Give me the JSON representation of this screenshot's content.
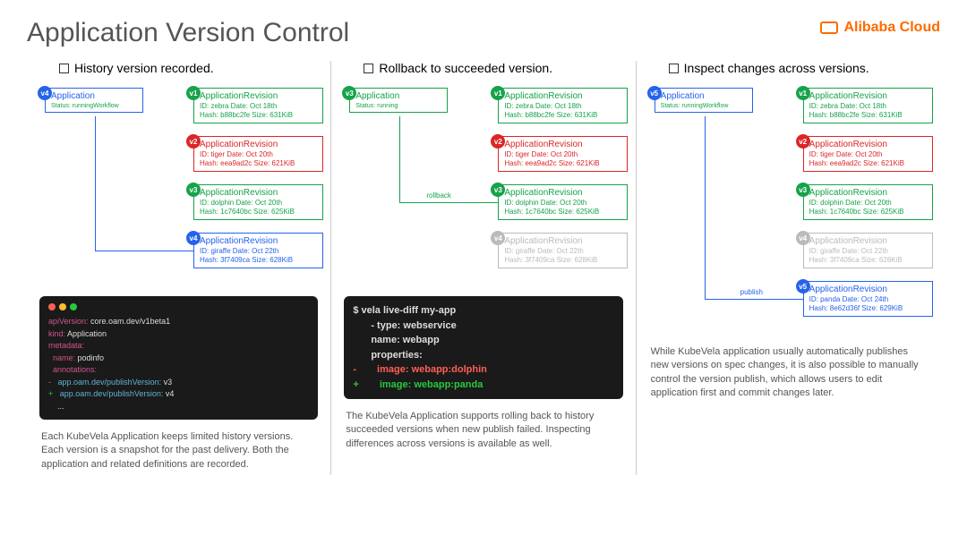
{
  "title": "Application Version Control",
  "logo": "Alibaba Cloud",
  "col1": {
    "heading": "History version recorded.",
    "app": {
      "title": "Application",
      "status": "Status: runningWorkflow",
      "badge": "v4"
    },
    "revs": [
      {
        "b": "v1",
        "t": "ApplicationRevision",
        "d": "ID: zebra Date: Oct 18th",
        "h": "Hash: b88bc2fe Size: 631KiB"
      },
      {
        "b": "v2",
        "t": "ApplicationRevision",
        "d": "ID: tiger Date: Oct 20th",
        "h": "Hash: eea9ad2c Size: 621KiB"
      },
      {
        "b": "v3",
        "t": "ApplicationRevision",
        "d": "ID: dolphin Date: Oct 20th",
        "h": "Hash: 1c7640bc Size: 625KiB"
      },
      {
        "b": "v4",
        "t": "ApplicationRevision",
        "d": "ID: giraffe Date: Oct 22th",
        "h": "Hash: 3f7409ca Size: 628KiB"
      }
    ],
    "code": {
      "l1": "apiVersion:",
      "v1": " core.oam.dev/v1beta1",
      "l2": "kind:",
      "v2": " Application",
      "l3": "metadata:",
      "l4": "name:",
      "v4": " podinfo",
      "l5": "annotations:",
      "l6": "app.oam.dev/publishVersion:",
      "v6a": " v3",
      "v6b": " v4",
      "l7": "..."
    },
    "desc": "Each KubeVela Application keeps limited history versions. Each version is a snapshot for the past delivery. Both the application and related definitions are recorded."
  },
  "col2": {
    "heading": "Rollback to succeeded version.",
    "app": {
      "title": "Application",
      "status": "Status: running",
      "badge": "v3"
    },
    "rollback": "rollback",
    "revs": [
      {
        "b": "v1",
        "t": "ApplicationRevision",
        "d": "ID: zebra Date: Oct 18th",
        "h": "Hash: b88bc2fe Size: 631KiB"
      },
      {
        "b": "v2",
        "t": "ApplicationRevision",
        "d": "ID: tiger Date: Oct 20th",
        "h": "Hash: eea9ad2c Size: 621KiB"
      },
      {
        "b": "v3",
        "t": "ApplicationRevision",
        "d": "ID: dolphin Date: Oct 20th",
        "h": "Hash: 1c7640bc Size: 625KiB"
      },
      {
        "b": "v4",
        "t": "ApplicationRevision",
        "d": "ID: giraffe Date: Oct 22th",
        "h": "Hash: 3f7409ca Size: 628KiB"
      }
    ],
    "code": {
      "cmd": "$ vela live-diff my-app",
      "l1": "- type: webservice",
      "l2": "  name: webapp",
      "l3": "  properties:",
      "l4": "-",
      "v4": "    image: webapp:dolphin",
      "l5": "+",
      "v5": "    image: webapp:panda"
    },
    "desc": "The KubeVela Application supports rolling back to history succeeded versions when new publish failed. Inspecting differences across versions is available as well."
  },
  "col3": {
    "heading": "Inspect changes across versions.",
    "app": {
      "title": "Application",
      "status": "Status: runningWorkflow",
      "badge": "v5"
    },
    "publish": "publish",
    "revs": [
      {
        "b": "v1",
        "t": "ApplicationRevision",
        "d": "ID: zebra Date: Oct 18th",
        "h": "Hash: b88bc2fe Size: 631KiB"
      },
      {
        "b": "v2",
        "t": "ApplicationRevision",
        "d": "ID: tiger Date: Oct 20th",
        "h": "Hash: eea9ad2c Size: 621KiB"
      },
      {
        "b": "v3",
        "t": "ApplicationRevision",
        "d": "ID: dolphin Date: Oct 20th",
        "h": "Hash: 1c7640bc Size: 625KiB"
      },
      {
        "b": "v4",
        "t": "ApplicationRevision",
        "d": "ID: giraffe Date: Oct 22th",
        "h": "Hash: 3f7409ca Size: 628KiB"
      },
      {
        "b": "v5",
        "t": "ApplicationRevision",
        "d": "ID: panda Date: Oct 24th",
        "h": "Hash: 8e62d36f Size: 629KiB"
      }
    ],
    "desc": "While KubeVela application usually automatically publishes new versions on spec changes, it is also possible to manually control the version publish, which allows users to edit application first and commit changes later."
  }
}
